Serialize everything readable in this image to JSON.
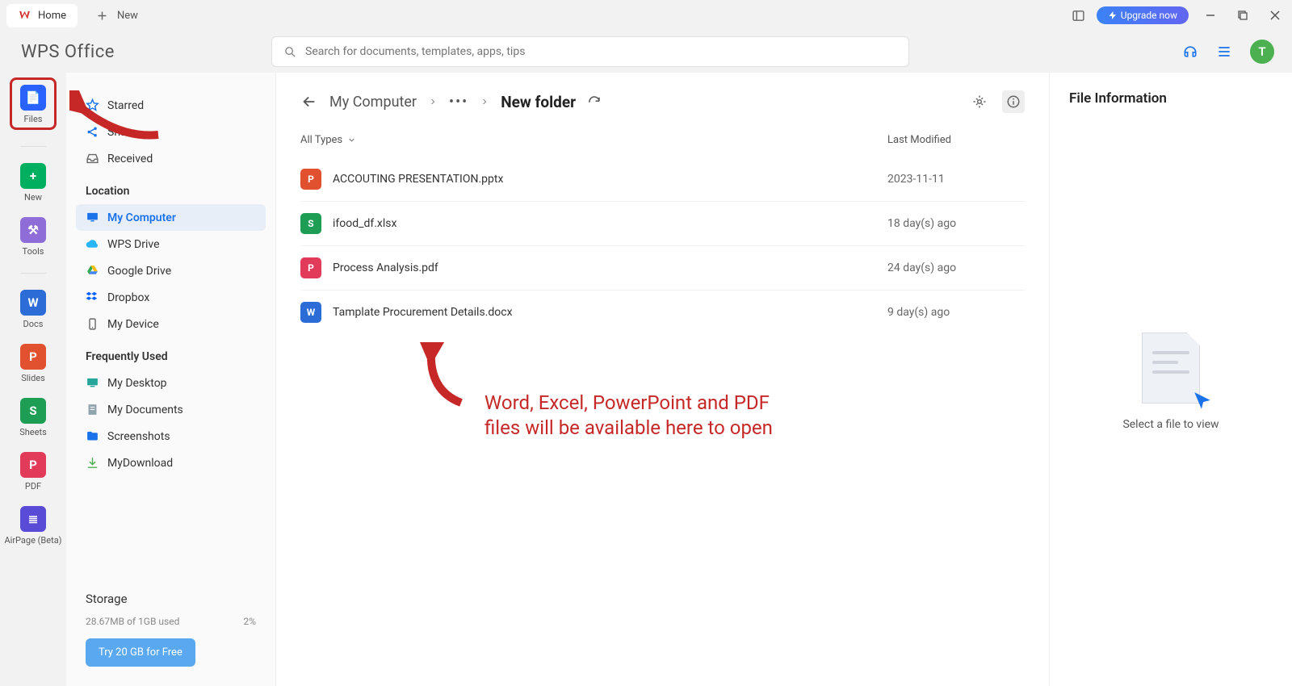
{
  "titlebar": {
    "home_label": "Home",
    "new_label": "New",
    "upgrade_label": "Upgrade now"
  },
  "logo_text": "WPS Office",
  "search": {
    "placeholder": "Search for documents, templates, apps, tips"
  },
  "avatar_initial": "T",
  "rail": [
    {
      "label": "Files",
      "color": "#2962ff",
      "glyph": "📄",
      "key": "files"
    },
    {
      "label": "New",
      "color": "#00b060",
      "glyph": "+",
      "key": "new"
    },
    {
      "label": "Tools",
      "color": "#8e6dd8",
      "glyph": "⚒",
      "key": "tools"
    },
    {
      "label": "Docs",
      "color": "#2b6cd6",
      "glyph": "W",
      "key": "docs"
    },
    {
      "label": "Slides",
      "color": "#e1502f",
      "glyph": "P",
      "key": "slides"
    },
    {
      "label": "Sheets",
      "color": "#1e9e55",
      "glyph": "S",
      "key": "sheets"
    },
    {
      "label": "PDF",
      "color": "#e23b5a",
      "glyph": "P",
      "key": "pdf"
    },
    {
      "label": "AirPage (Beta)",
      "color": "#5a4bd6",
      "glyph": "≣",
      "key": "airpage"
    }
  ],
  "sidebar": {
    "top": [
      {
        "label": "Starred",
        "icon": "star"
      },
      {
        "label": "Share",
        "icon": "share"
      },
      {
        "label": "Received",
        "icon": "inbox"
      }
    ],
    "location_header": "Location",
    "locations": [
      {
        "label": "My Computer",
        "icon": "monitor",
        "active": true
      },
      {
        "label": "WPS Drive",
        "icon": "cloud"
      },
      {
        "label": "Google Drive",
        "icon": "gdrive"
      },
      {
        "label": "Dropbox",
        "icon": "dropbox"
      },
      {
        "label": "My Device",
        "icon": "device"
      }
    ],
    "freq_header": "Frequently Used",
    "freq": [
      {
        "label": "My Desktop",
        "icon": "desktop"
      },
      {
        "label": "My Documents",
        "icon": "docfolder"
      },
      {
        "label": "Screenshots",
        "icon": "folder"
      },
      {
        "label": "MyDownload",
        "icon": "download"
      }
    ],
    "storage": {
      "title": "Storage",
      "used_text": "28.67MB of 1GB used",
      "percent": "2%",
      "cta": "Try 20 GB for Free"
    }
  },
  "breadcrumb": {
    "root": "My Computer",
    "current": "New folder"
  },
  "columns": {
    "types": "All Types",
    "modified": "Last Modified"
  },
  "files": [
    {
      "name": "ACCOUTING PRESENTATION.pptx",
      "mod": "2023-11-11",
      "icon": "P",
      "color": "#e1502f"
    },
    {
      "name": "ifood_df.xlsx",
      "mod": "18 day(s) ago",
      "icon": "S",
      "color": "#1e9e55"
    },
    {
      "name": "Process Analysis.pdf",
      "mod": "24 day(s) ago",
      "icon": "P",
      "color": "#e23b5a"
    },
    {
      "name": "Tamplate Procurement Details.docx",
      "mod": "9 day(s) ago",
      "icon": "W",
      "color": "#2b6cd6"
    }
  ],
  "info_panel": {
    "title": "File Information",
    "empty_text": "Select a file to view"
  },
  "annotation": {
    "line1": "Word, Excel, PowerPoint and PDF",
    "line2": "files will be available here to open"
  }
}
